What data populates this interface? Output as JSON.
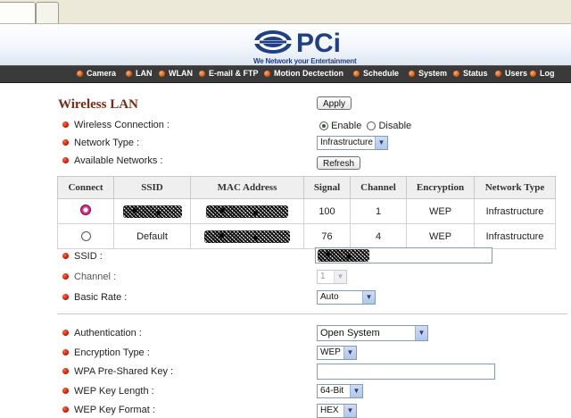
{
  "brand": {
    "logo_text": "PCi",
    "tagline": "We Network your Entertainment"
  },
  "nav": {
    "items": [
      "Camera",
      "LAN",
      "WLAN",
      "E-mail & FTP",
      "Motion Dectection",
      "Schedule",
      "System",
      "Status",
      "Users",
      "Log"
    ]
  },
  "page": {
    "title": "Wireless LAN",
    "apply_label": "Apply",
    "refresh_label": "Refresh"
  },
  "form": {
    "wireless_connection_label": "Wireless Connection :",
    "enable_label": "Enable",
    "disable_label": "Disable",
    "wireless_connection_value": "Enable",
    "network_type_label": "Network Type :",
    "network_type_value": "Infrastructure",
    "available_networks_label": "Available Networks :",
    "ssid_label": "SSID :",
    "channel_label": "Channel :",
    "channel_value": "1",
    "basic_rate_label": "Basic Rate :",
    "basic_rate_value": "Auto",
    "authentication_label": "Authentication :",
    "authentication_value": "Open System",
    "encryption_type_label": "Encryption Type :",
    "encryption_type_value": "WEP",
    "wpa_key_label": "WPA Pre-Shared Key :",
    "wep_key_length_label": "WEP Key Length :",
    "wep_key_length_value": "64-Bit",
    "wep_key_format_label": "WEP Key Format :",
    "wep_key_format_value": "HEX"
  },
  "networks": {
    "headers": [
      "Connect",
      "SSID",
      "MAC Address",
      "Signal",
      "Channel",
      "Encryption",
      "Network Type"
    ],
    "rows": [
      {
        "ssid": "",
        "mac": "",
        "signal": "100",
        "channel": "1",
        "encryption": "WEP",
        "type": "Infrastructure",
        "selected": true
      },
      {
        "ssid": "Default",
        "mac": "",
        "signal": "76",
        "channel": "4",
        "encryption": "WEP",
        "type": "Infrastructure",
        "selected": false
      }
    ]
  },
  "colors": {
    "title": "#7a2a12",
    "navbar": "#3a3a3a",
    "brand_blue": "#1f3f86"
  }
}
